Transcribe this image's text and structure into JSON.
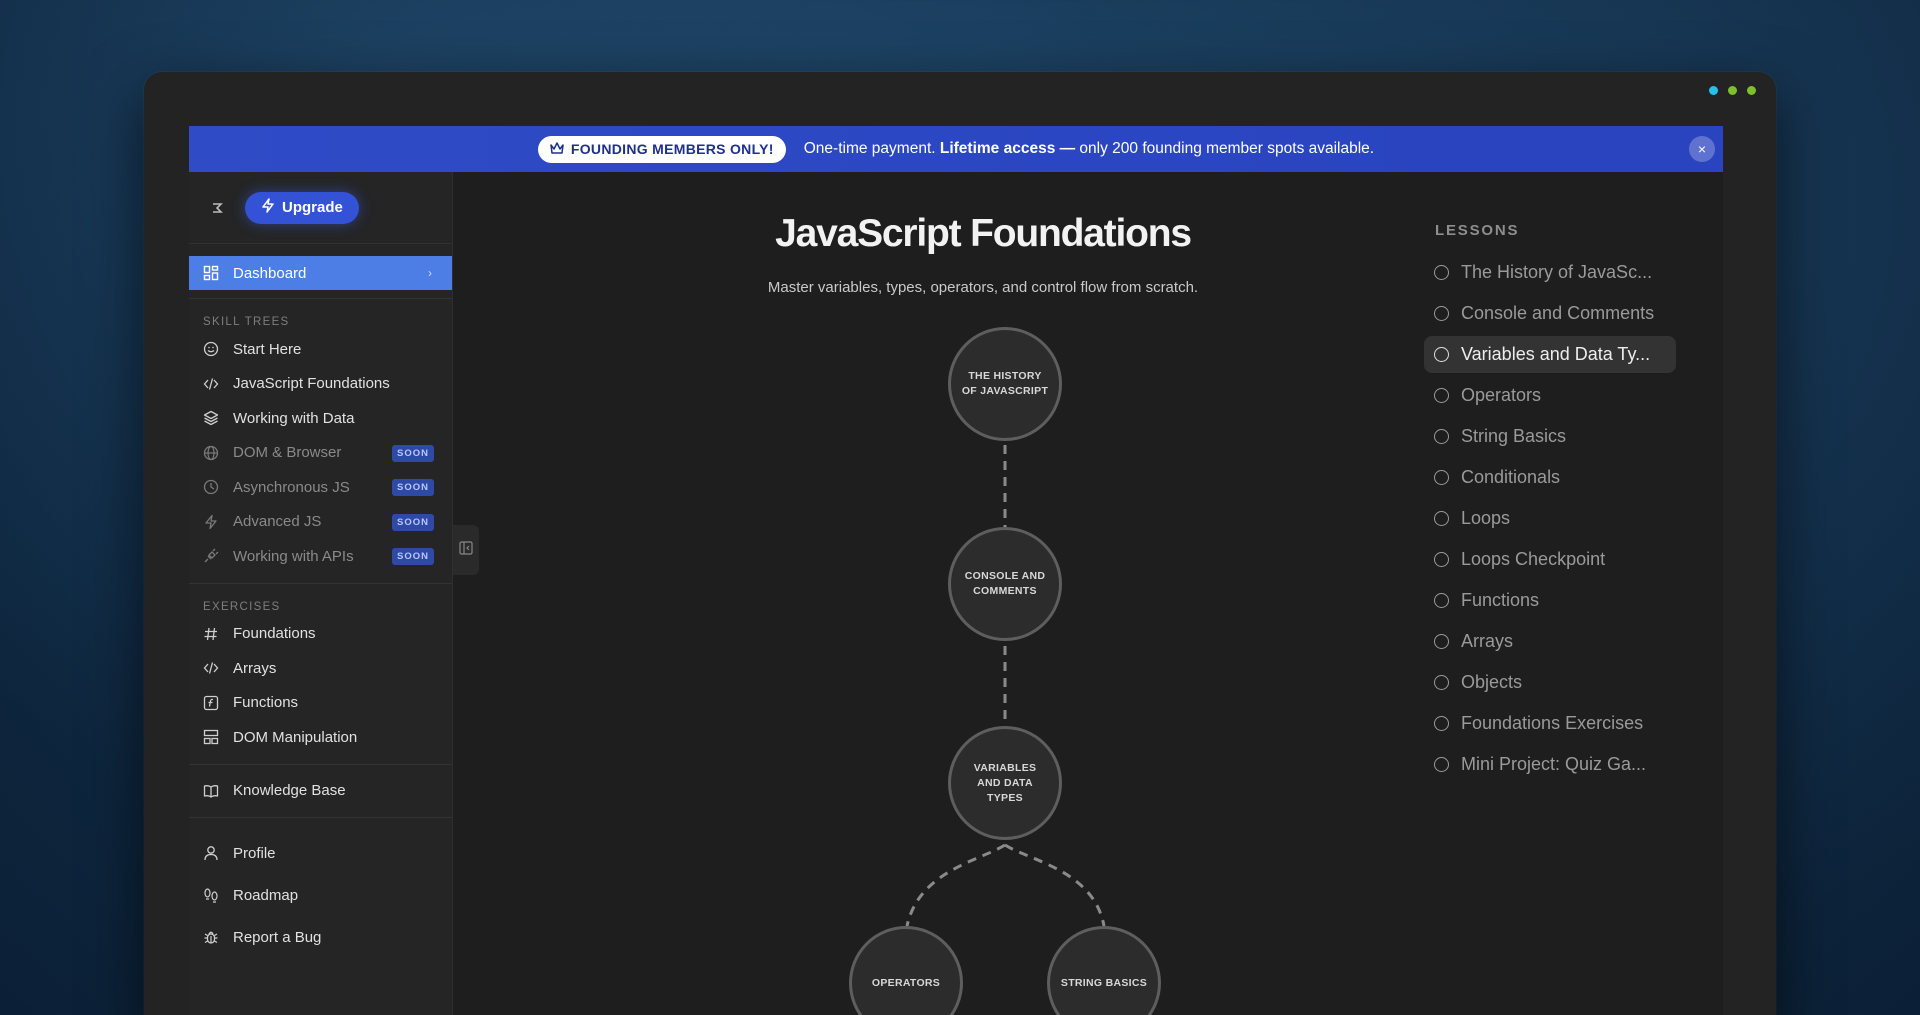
{
  "window": {
    "dot_colors": [
      "#22c3e6",
      "#7fbf2a",
      "#7fbf2a"
    ]
  },
  "banner": {
    "pill_label": "FOUNDING MEMBERS ONLY!",
    "text_normal": "One-time payment. ",
    "text_bold": "Lifetime access —",
    "text_tail": " only 200 founding member spots available.",
    "close_label": "×"
  },
  "sidebar": {
    "upgrade_label": "Upgrade",
    "dashboard_label": "Dashboard",
    "skill_trees_label": "SKILL TREES",
    "skill_trees": [
      {
        "label": "Start Here",
        "icon": "smile-icon",
        "soon": ""
      },
      {
        "label": "JavaScript Foundations",
        "icon": "code-icon",
        "soon": ""
      },
      {
        "label": "Working with Data",
        "icon": "layers-icon",
        "soon": ""
      },
      {
        "label": "DOM & Browser",
        "icon": "globe-icon",
        "soon": "SOON"
      },
      {
        "label": "Asynchronous JS",
        "icon": "clock-icon",
        "soon": "SOON"
      },
      {
        "label": "Advanced JS",
        "icon": "bolt-icon",
        "soon": "SOON"
      },
      {
        "label": "Working with APIs",
        "icon": "plug-icon",
        "soon": "SOON"
      }
    ],
    "exercises_label": "EXERCISES",
    "exercises": [
      {
        "label": "Foundations",
        "icon": "hash-icon"
      },
      {
        "label": "Arrays",
        "icon": "code-icon"
      },
      {
        "label": "Functions",
        "icon": "function-icon"
      },
      {
        "label": "DOM Manipulation",
        "icon": "layout-icon"
      }
    ],
    "knowledge_base_label": "Knowledge Base",
    "bottom": [
      {
        "label": "Profile",
        "icon": "user-icon"
      },
      {
        "label": "Roadmap",
        "icon": "footprints-icon"
      },
      {
        "label": "Report a Bug",
        "icon": "bug-icon"
      }
    ]
  },
  "main": {
    "title": "JavaScript Foundations",
    "subtitle": "Master variables, types, operators, and control flow from scratch.",
    "nodes": [
      "THE HISTORY OF JAVASCRIPT",
      "CONSOLE AND COMMENTS",
      "VARIABLES AND DATA TYPES",
      "OPERATORS",
      "STRING BASICS"
    ]
  },
  "lessons": {
    "label": "LESSONS",
    "items": [
      {
        "label": "The History of JavaSc...",
        "active": false
      },
      {
        "label": "Console and Comments",
        "active": false
      },
      {
        "label": "Variables and Data Ty...",
        "active": true
      },
      {
        "label": "Operators",
        "active": false
      },
      {
        "label": "String Basics",
        "active": false
      },
      {
        "label": "Conditionals",
        "active": false
      },
      {
        "label": "Loops",
        "active": false
      },
      {
        "label": "Loops Checkpoint",
        "active": false
      },
      {
        "label": "Functions",
        "active": false
      },
      {
        "label": "Arrays",
        "active": false
      },
      {
        "label": "Objects",
        "active": false
      },
      {
        "label": "Foundations Exercises",
        "active": false
      },
      {
        "label": "Mini Project: Quiz Ga...",
        "active": false
      }
    ]
  }
}
